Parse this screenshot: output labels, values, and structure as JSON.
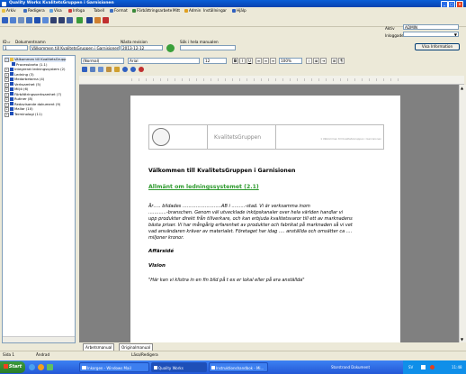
{
  "window": {
    "title": "Quality Works KvalitetsGruppen i Garnisionen"
  },
  "menu": {
    "items": [
      "Arkiv",
      "Redigera",
      "Visa",
      "Infoga",
      "Tabell",
      "Format",
      "Förbättringsarbete",
      "Mitt",
      "Admin",
      "Inställningar",
      "Hjälp"
    ]
  },
  "login": {
    "aktiv_label": "Aktiv",
    "aktiv_value": "ADMIN",
    "inloggade_label": "Inloggade",
    "show_info_button": "Visa Information"
  },
  "doc_fields": {
    "id_label": "ID",
    "id_value": "1",
    "name_label": "Dokumentnamn",
    "name_value": "Välkommen till KvalitetsGruppen i Garnisionen",
    "next_revision_label": "Nästa revision",
    "next_revision_value": "2013-12-12",
    "search_label": "Sök i hela manualen",
    "search_value": ""
  },
  "tree": {
    "items": [
      "Välkommen till KvalitetsGrupp",
      "Processkarta (1.1)",
      "Integrerat ledningssystem (2)",
      "Ledning (3)",
      "Medarbetarna (4)",
      "Verksamhet (5)",
      "Miljö (6)",
      "Förbättringsverksamhet (7)",
      "Rutiner (8)",
      "Redovisande dokument (9)",
      "Mallar (10)",
      "Terminologi (11)"
    ]
  },
  "editor": {
    "style": "(Normal)",
    "font": "Arial",
    "size": "12",
    "zoom": "100%"
  },
  "document": {
    "header_company": "KvalitetsGruppen",
    "header_right": "1 Välkommen till KvalitetsGruppen i Garnisionen",
    "heading": "Välkommen till KvalitetsGruppen i Garnisionen",
    "subheading": "Allmänt om ledningssystemet (2.1)",
    "paragraph_lines": [
      "År….. bildades ……………………..AB i ………-stad. Vi är verksamma inom",
      "…………-branschen. Genom väl utvecklade inköpskanaler over hela världen handlar vi",
      "upp produkter direkt från tillverkare, och kan erbjuda kvalitetsvaror till ett av marknadens",
      "bästa priser. Vi har mångårig erfarenhet av produkter och fabrikat på marknaden så vi vet",
      "vad användaren kräver av materialet. Företaget har idag …. anställda och omsätter ca ….",
      "miljoner kronor."
    ],
    "section1": "Affärsidé",
    "section2": "Vision",
    "quote": "\"Här kan vi klistra in en fin bild på t ex er lokal eller på era anställda\""
  },
  "bottom_tabs": [
    "Arbetsmanual",
    "Originalmanual"
  ],
  "status": {
    "page": "Sida 1",
    "edit_state": "Ändrad",
    "mode": "Läsa/Redigera",
    "size_label": "Storstrand"
  },
  "taskbar": {
    "start": "Start",
    "tasks": [
      "Inkorgen - Windows Mail",
      "Quality Works",
      "Instruktionshandbok - Mi..."
    ],
    "tray_lang": "SV",
    "clock": "11:48",
    "tray_extra": "Storstrand  Dokument"
  },
  "colors": {
    "heading_green": "#2e9a2e",
    "title_blue": "#0842b0"
  }
}
